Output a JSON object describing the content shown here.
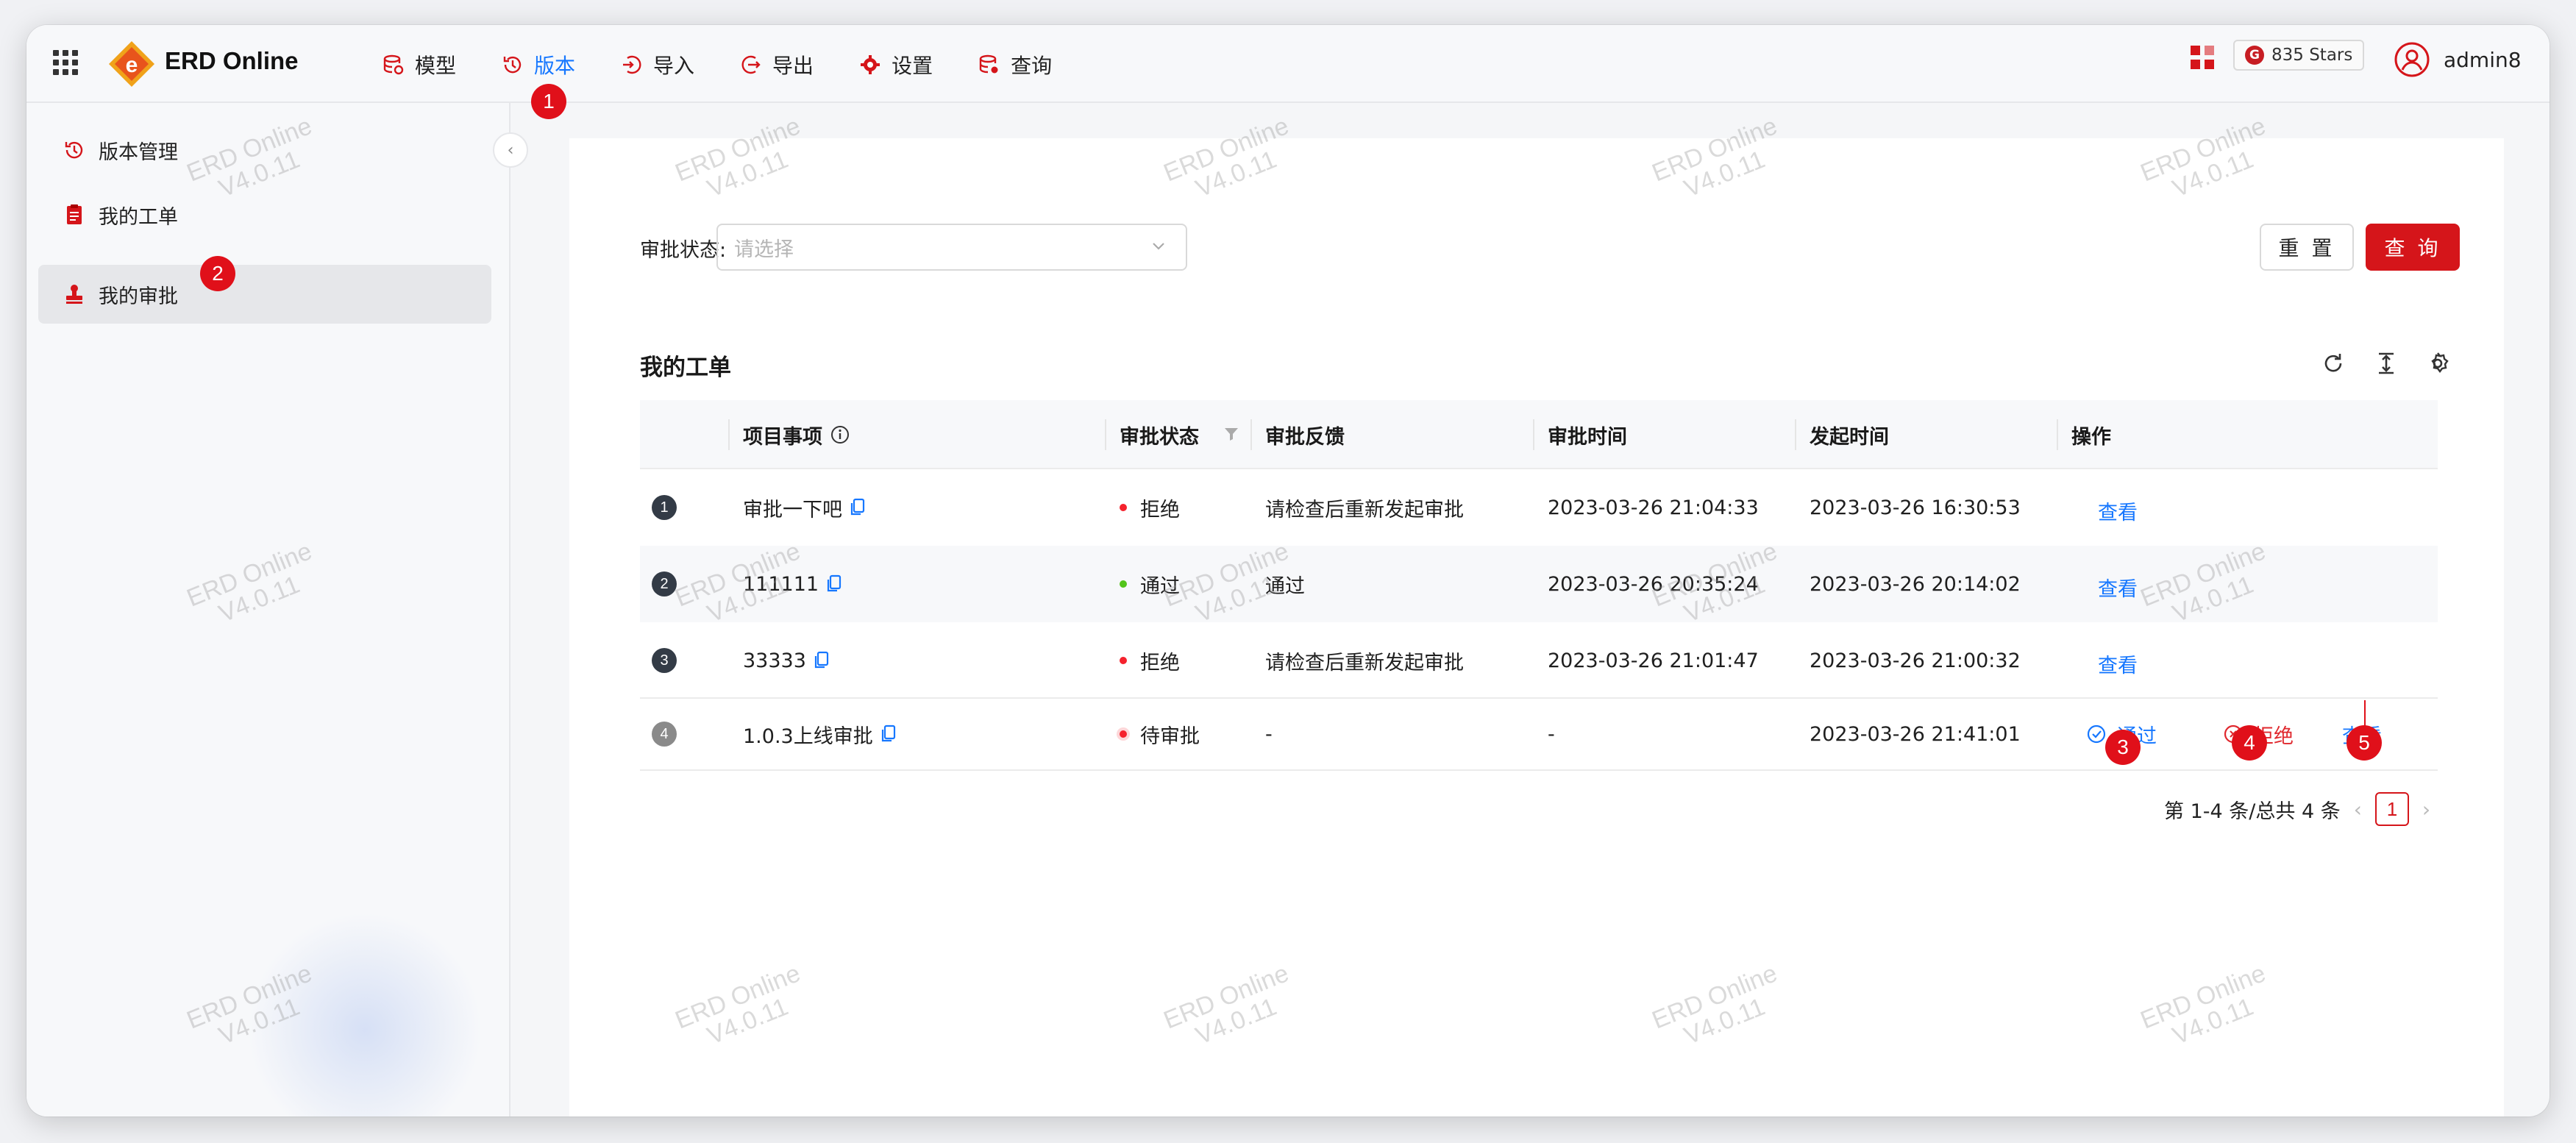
{
  "app": {
    "brand": "ERD Online"
  },
  "nav": [
    {
      "label": "模型",
      "icon": "database-icon"
    },
    {
      "label": "版本",
      "icon": "history-icon",
      "active": true
    },
    {
      "label": "导入",
      "icon": "import-icon"
    },
    {
      "label": "导出",
      "icon": "export-icon"
    },
    {
      "label": "设置",
      "icon": "gear-icon"
    },
    {
      "label": "查询",
      "icon": "database-search-icon"
    }
  ],
  "header_right": {
    "stars": "835 Stars",
    "username": "admin8"
  },
  "sidebar": {
    "items": [
      {
        "label": "版本管理",
        "icon": "history-icon"
      },
      {
        "label": "我的工单",
        "icon": "document-icon"
      },
      {
        "label": "我的审批",
        "icon": "stamp-icon",
        "active": true
      }
    ]
  },
  "filter": {
    "label": "审批状态:",
    "placeholder": "请选择",
    "reset": "重 置",
    "query": "查 询"
  },
  "table": {
    "title": "我的工单",
    "columns": [
      "项目事项",
      "审批状态",
      "审批反馈",
      "审批时间",
      "发起时间",
      "操作"
    ],
    "rows": [
      {
        "index": "1",
        "item": "审批一下吧",
        "status": "拒绝",
        "status_color": "#f5222d",
        "feedback": "请检查后重新发起审批",
        "approve_time": "2023-03-26 21:04:33",
        "start_time": "2023-03-26 16:30:53",
        "action": "查看"
      },
      {
        "index": "2",
        "item": "111111",
        "status": "通过",
        "status_color": "#52c41a",
        "feedback": "通过",
        "approve_time": "2023-03-26 20:35:24",
        "start_time": "2023-03-26 20:14:02",
        "action": "查看"
      },
      {
        "index": "3",
        "item": "33333",
        "status": "拒绝",
        "status_color": "#f5222d",
        "feedback": "请检查后重新发起审批",
        "approve_time": "2023-03-26 21:01:47",
        "start_time": "2023-03-26 21:00:32",
        "action": "查看"
      },
      {
        "index": "4",
        "item": "1.0.3上线审批",
        "status": "待审批",
        "status_color": "#f5222d",
        "feedback": "-",
        "approve_time": "-",
        "start_time": "2023-03-26 21:41:01",
        "actions": [
          "通过",
          "拒绝",
          "查看"
        ]
      }
    ]
  },
  "pagination": {
    "summary": "第 1-4 条/总共 4 条",
    "current": "1"
  },
  "markers": [
    "1",
    "2",
    "3",
    "4",
    "5"
  ],
  "watermark": {
    "line1": "ERD Online",
    "line2": "V4.0.11"
  },
  "colors": {
    "accent": "#1677ff",
    "brand_red": "#d5151a",
    "marker_red": "#e0101a"
  }
}
